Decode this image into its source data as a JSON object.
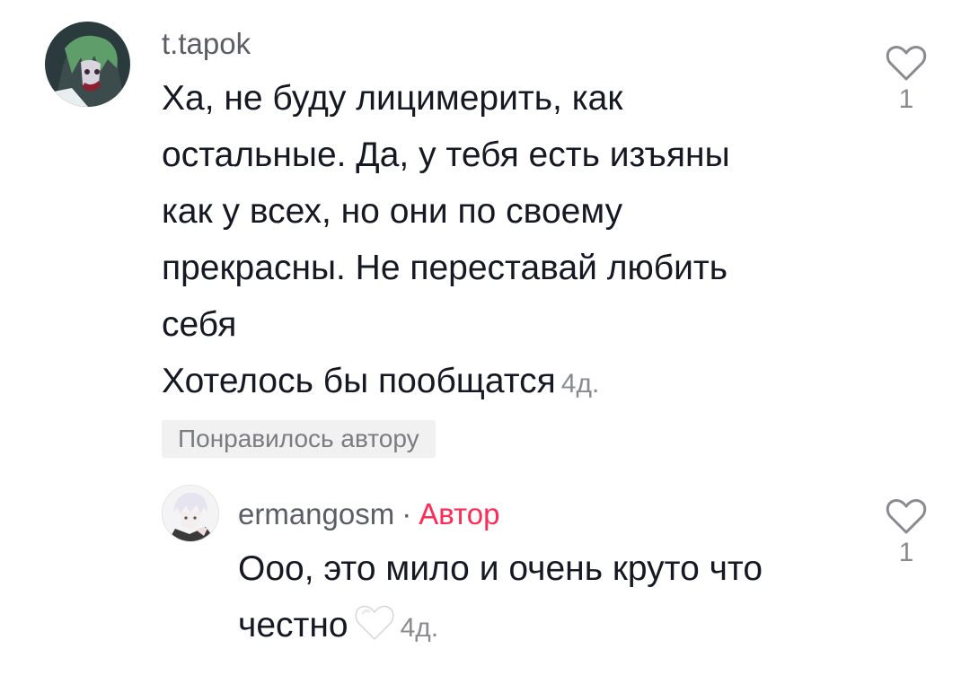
{
  "comments": [
    {
      "username": "t.tapok",
      "text_lines": [
        "Ха, не буду лицимерить, как",
        "остальные. Да, у тебя есть изъяны",
        "как у всех, но они по своему",
        "прекрасны. Не переставай любить",
        "себя",
        "Хотелось бы пообщатся"
      ],
      "timestamp": "4д.",
      "liked_by_author_label": "Понравилось автору",
      "like_count": "1",
      "avatar_icon": "user-avatar-green-hair"
    }
  ],
  "reply": {
    "username": "ermangosm",
    "separator": "·",
    "author_tag": "Автор",
    "text_lines": [
      "Ооо, это мило и очень круто что",
      "честно"
    ],
    "emoji": "white-heart-icon",
    "timestamp": "4д.",
    "like_count": "1",
    "avatar_icon": "user-avatar-white-hair"
  },
  "colors": {
    "author_tag": "#fe2c55",
    "username": "#5c5e66",
    "secondary_text": "#8a8b91",
    "badge_bg": "#f1f1f2"
  }
}
